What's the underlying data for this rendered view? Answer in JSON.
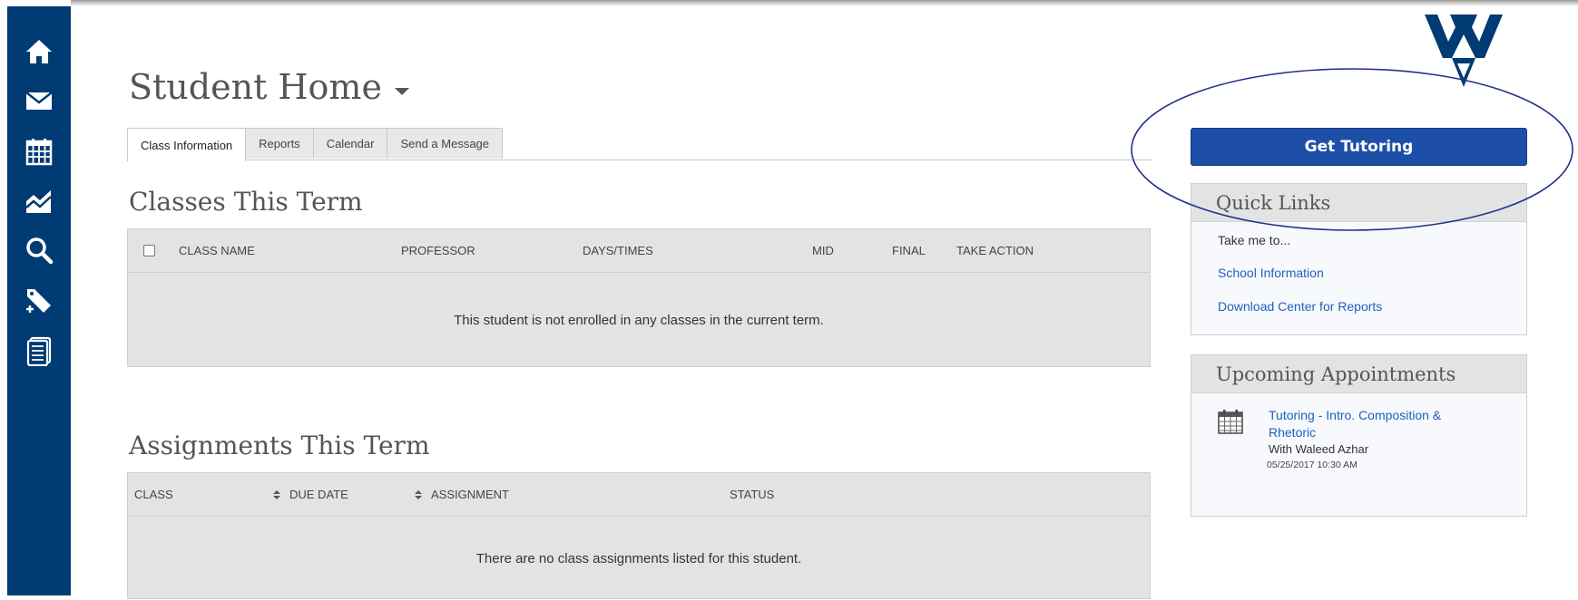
{
  "sidebar": {
    "icons": [
      "home-icon",
      "mail-icon",
      "calendar-icon",
      "chart-icon",
      "search-icon",
      "tag-icon",
      "notebook-icon"
    ]
  },
  "header": {
    "title": "Student Home"
  },
  "tabs": [
    {
      "label": "Class Information",
      "active": true
    },
    {
      "label": "Reports",
      "active": false
    },
    {
      "label": "Calendar",
      "active": false
    },
    {
      "label": "Send a Message",
      "active": false
    }
  ],
  "classes": {
    "title": "Classes This Term",
    "columns": [
      "CLASS NAME",
      "PROFESSOR",
      "DAYS/TIMES",
      "MID",
      "FINAL",
      "TAKE ACTION"
    ],
    "empty_message": "This student is not enrolled in any classes in the current term."
  },
  "assignments": {
    "title": "Assignments This Term",
    "columns": [
      "CLASS",
      "DUE DATE",
      "ASSIGNMENT",
      "STATUS"
    ],
    "empty_message": "There are no class assignments listed for this student."
  },
  "right": {
    "tutoring_button": "Get Tutoring",
    "quick_links": {
      "title": "Quick Links",
      "intro": "Take me to...",
      "links": [
        "School Information",
        "Download Center for Reports"
      ]
    },
    "appointments": {
      "title": "Upcoming Appointments",
      "items": [
        {
          "title": "Tutoring - Intro. Composition & Rhetoric",
          "with": "With Waleed Azhar",
          "time": "05/25/2017 10:30 AM"
        }
      ]
    }
  },
  "colors": {
    "sidebar": "#003b73",
    "button": "#1e4fa8",
    "link": "#1f5fbf",
    "highlight": "#22318a"
  }
}
